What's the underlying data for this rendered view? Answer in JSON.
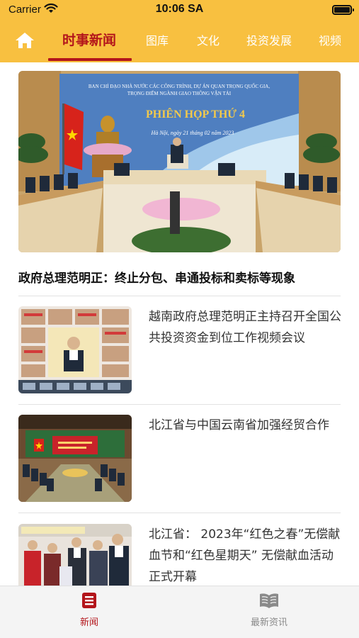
{
  "status_bar": {
    "carrier": "Carrier",
    "time": "10:06 SA"
  },
  "nav": {
    "home_icon": "home-icon",
    "tabs": [
      {
        "label": "时事新闻",
        "active": true
      },
      {
        "label": "图库",
        "active": false
      },
      {
        "label": "文化",
        "active": false
      },
      {
        "label": "投资发展",
        "active": false
      },
      {
        "label": "视频",
        "active": false
      }
    ],
    "accent_color": "#b3151b",
    "bar_color": "#f8c040"
  },
  "feed": {
    "hero": {
      "title": "政府总理范明正：终止分包、串通投标和卖标等现象",
      "image": {
        "banner_line1": "BAN CHỈ ĐẠO NHÀ NƯỚC CÁC CÔNG TRÌNH, DỰ ÁN QUAN TRỌNG QUỐC GIA,",
        "banner_line2": "TRỌNG ĐIỂM NGÀNH GIAO THÔNG VẬN TẢI",
        "banner_title": "PHIÊN HỌP THỨ 4",
        "banner_date": "Hà Nội, ngày 21 tháng 02 năm 2023"
      }
    },
    "items": [
      {
        "title": "越南政府总理范明正主持召开全国公共投资资金到位工作视频会议"
      },
      {
        "title": "北江省与中国云南省加强经贸合作"
      },
      {
        "title": "北江省： 2023年“红色之春”无偿献血节和“红色星期天” 无偿献血活动正式开幕"
      }
    ]
  },
  "tab_bar": {
    "items": [
      {
        "label": "新闻",
        "icon": "news-icon",
        "active": true
      },
      {
        "label": "最新资讯",
        "icon": "book-icon",
        "active": false
      }
    ]
  }
}
